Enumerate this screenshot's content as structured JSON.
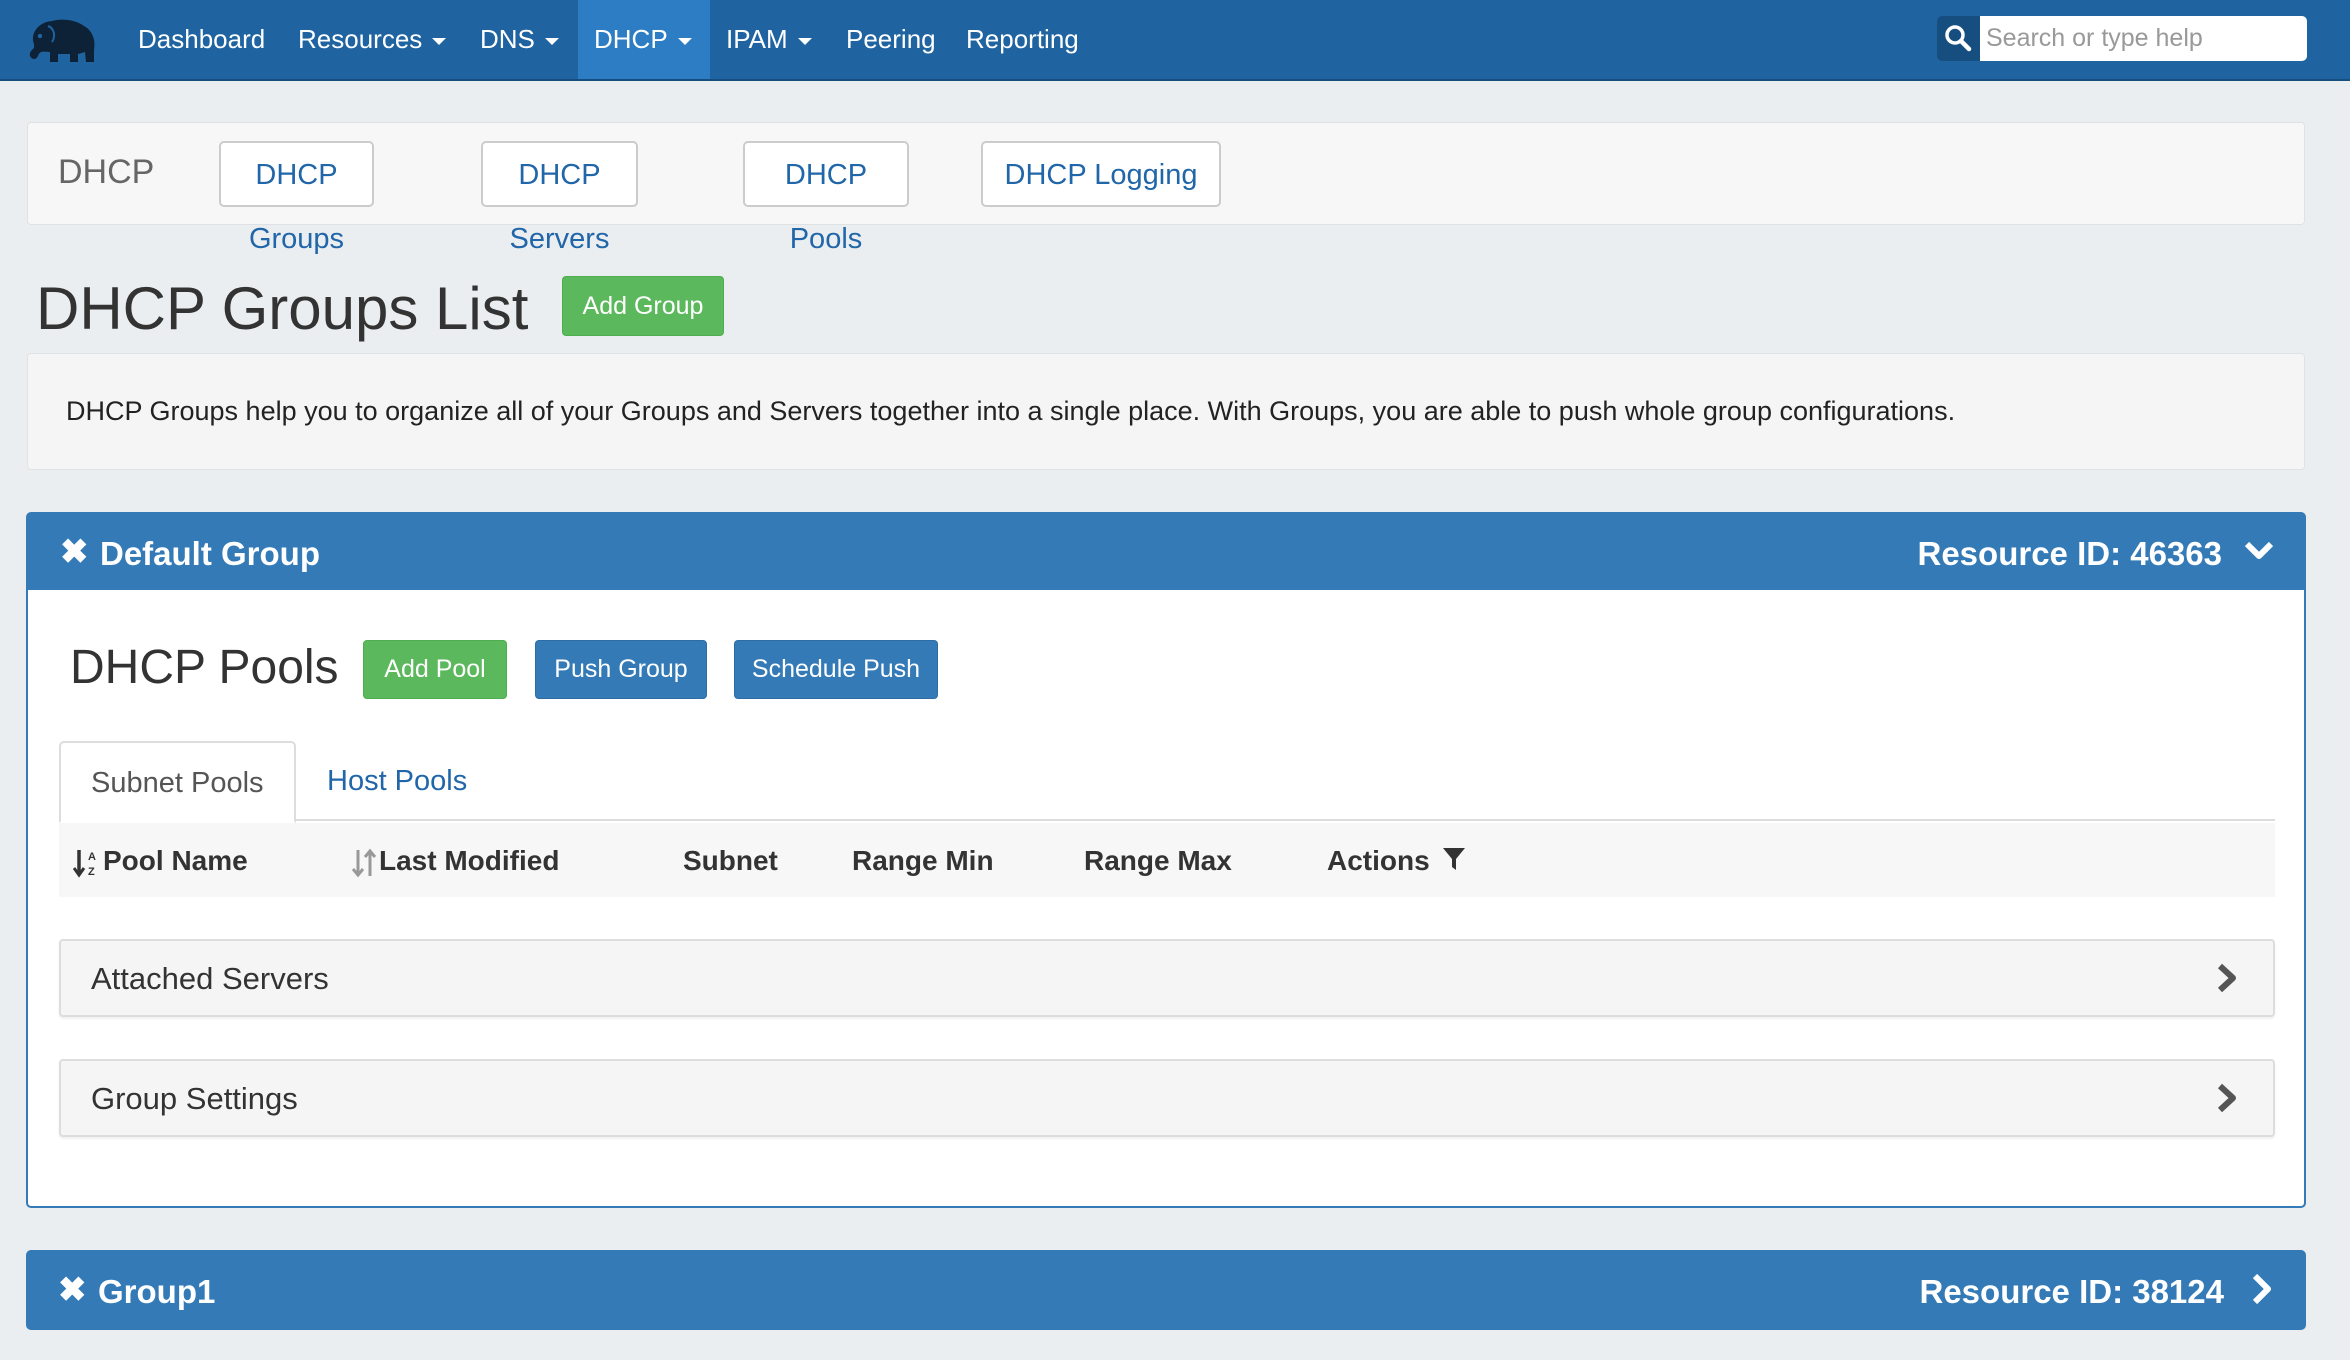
{
  "nav": {
    "items": [
      {
        "label": "Dashboard",
        "dropdown": false,
        "active": false
      },
      {
        "label": "Resources",
        "dropdown": true,
        "active": false
      },
      {
        "label": "DNS",
        "dropdown": true,
        "active": false
      },
      {
        "label": "DHCP",
        "dropdown": true,
        "active": true
      },
      {
        "label": "IPAM",
        "dropdown": true,
        "active": false
      },
      {
        "label": "Peering",
        "dropdown": false,
        "active": false
      },
      {
        "label": "Reporting",
        "dropdown": false,
        "active": false
      }
    ],
    "search_placeholder": "Search or type help",
    "colors": {
      "bar": "#1f63a1",
      "active": "#2d7dc4"
    }
  },
  "subnav": {
    "title": "DHCP",
    "buttons": [
      "DHCP Groups",
      "DHCP Servers",
      "DHCP Pools",
      "DHCP Logging"
    ]
  },
  "page": {
    "title": "DHCP Groups List",
    "add_group_label": "Add Group",
    "description": "DHCP Groups help you to organize all of your Groups and Servers together into a single place. With Groups, you are able to push whole group configurations."
  },
  "groups": [
    {
      "close_glyph": "✖",
      "name": "Default Group",
      "resource_id": "Resource ID: 46363",
      "expanded": true,
      "pools_title": "DHCP Pools",
      "add_pool_label": "Add Pool",
      "push_group_label": "Push Group",
      "schedule_push_label": "Schedule Push",
      "tabs": [
        "Subnet Pools",
        "Host Pools"
      ],
      "columns": [
        "Pool Name",
        "Last Modified",
        "Subnet",
        "Range Min",
        "Range Max",
        "Actions"
      ],
      "sections": [
        "Attached Servers",
        "Group Settings"
      ]
    },
    {
      "close_glyph": "✖",
      "name": "Group1",
      "resource_id": "Resource ID: 38124",
      "expanded": false
    }
  ],
  "colors": {
    "primary": "#337ab7",
    "success": "#5cb85c",
    "link": "#2066a8",
    "page_bg": "#ebeef1"
  }
}
